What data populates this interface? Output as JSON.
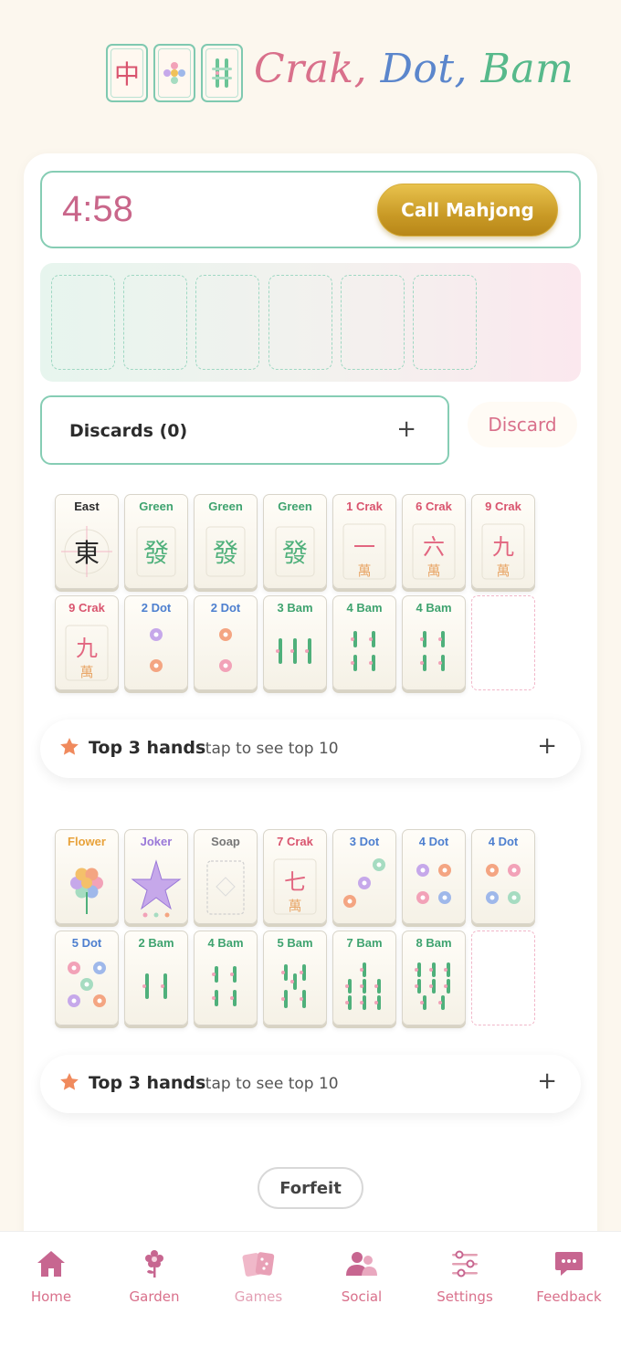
{
  "app": {
    "logo_tiles": [
      "中",
      "✿",
      "‖‖"
    ],
    "title_parts": [
      "Crak,",
      "Dot,",
      "Bam"
    ]
  },
  "game": {
    "timer": "4:58",
    "call_label": "Call Mahjong",
    "discards_label": "Discards (0)",
    "discards_expand": "+",
    "discard_button": "Discard",
    "forfeit_label": "Forfeit"
  },
  "racks": [
    {
      "rows": [
        [
          {
            "label": "East",
            "color": "#2a2a2a",
            "art": "wind",
            "glyph": "東"
          },
          {
            "label": "Green",
            "color": "#3fa36f",
            "art": "dragon",
            "glyph": "發"
          },
          {
            "label": "Green",
            "color": "#3fa36f",
            "art": "dragon",
            "glyph": "發"
          },
          {
            "label": "Green",
            "color": "#3fa36f",
            "art": "dragon",
            "glyph": "發"
          },
          {
            "label": "1 Crak",
            "color": "#d9546e",
            "art": "crak",
            "glyph": "一",
            "sub": "萬"
          },
          {
            "label": "6 Crak",
            "color": "#d9546e",
            "art": "crak",
            "glyph": "六",
            "sub": "萬"
          },
          {
            "label": "9 Crak",
            "color": "#d9546e",
            "art": "crak",
            "glyph": "九",
            "sub": "萬"
          }
        ],
        [
          {
            "label": "9 Crak",
            "color": "#d9546e",
            "art": "crak",
            "glyph": "九",
            "sub": "萬"
          },
          {
            "label": "2 Dot",
            "color": "#4d7fcf",
            "art": "dot",
            "n": 2
          },
          {
            "label": "2 Dot",
            "color": "#4d7fcf",
            "art": "dot",
            "n": 2
          },
          {
            "label": "3 Bam",
            "color": "#3fa36f",
            "art": "bam",
            "n": 3
          },
          {
            "label": "4 Bam",
            "color": "#3fa36f",
            "art": "bam",
            "n": 4
          },
          {
            "label": "4 Bam",
            "color": "#3fa36f",
            "art": "bam",
            "n": 4
          },
          {
            "empty": true
          }
        ]
      ],
      "top3_title": "Top 3 hands",
      "top3_hint": "· tap to see top 10",
      "top3_expand": "+"
    },
    {
      "rows": [
        [
          {
            "label": "Flower",
            "color": "#e8a23a",
            "art": "flower"
          },
          {
            "label": "Joker",
            "color": "#9a78d8",
            "art": "joker"
          },
          {
            "label": "Soap",
            "color": "#777777",
            "art": "soap"
          },
          {
            "label": "7 Crak",
            "color": "#d9546e",
            "art": "crak",
            "glyph": "七",
            "sub": "萬"
          },
          {
            "label": "3 Dot",
            "color": "#4d7fcf",
            "art": "dot",
            "n": 3
          },
          {
            "label": "4 Dot",
            "color": "#4d7fcf",
            "art": "dot",
            "n": 4
          },
          {
            "label": "4 Dot",
            "color": "#4d7fcf",
            "art": "dot",
            "n": 4
          }
        ],
        [
          {
            "label": "5 Dot",
            "color": "#4d7fcf",
            "art": "dot",
            "n": 5
          },
          {
            "label": "2 Bam",
            "color": "#3fa36f",
            "art": "bam",
            "n": 2
          },
          {
            "label": "4 Bam",
            "color": "#3fa36f",
            "art": "bam",
            "n": 4
          },
          {
            "label": "5 Bam",
            "color": "#3fa36f",
            "art": "bam",
            "n": 5
          },
          {
            "label": "7 Bam",
            "color": "#3fa36f",
            "art": "bam",
            "n": 7
          },
          {
            "label": "8 Bam",
            "color": "#3fa36f",
            "art": "bam",
            "n": 8
          },
          {
            "empty": true
          }
        ]
      ],
      "top3_title": "Top 3 hands",
      "top3_hint": "· tap to see top 10",
      "top3_expand": "+"
    }
  ],
  "nav": [
    {
      "label": "Home",
      "icon": "home-icon"
    },
    {
      "label": "Garden",
      "icon": "flower-icon"
    },
    {
      "label": "Games",
      "icon": "cards-icon",
      "active": true
    },
    {
      "label": "Social",
      "icon": "people-icon"
    },
    {
      "label": "Settings",
      "icon": "sliders-icon"
    },
    {
      "label": "Feedback",
      "icon": "chat-icon"
    }
  ]
}
